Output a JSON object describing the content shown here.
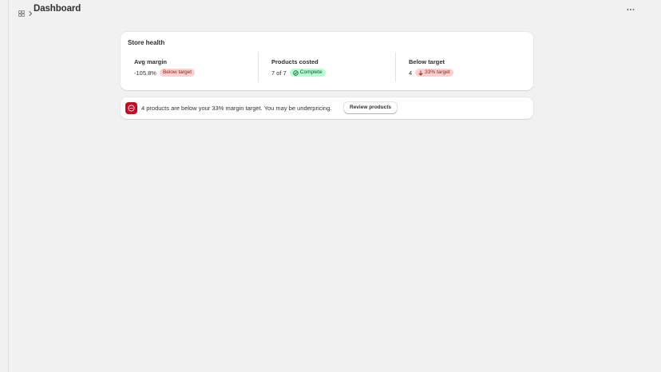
{
  "header": {
    "app_icon": "app-grid-icon",
    "separator_icon": "chevron-right-icon",
    "title": "Dashboard",
    "more_icon": "more-horizontal-icon"
  },
  "store_health": {
    "title": "Store health",
    "metrics": [
      {
        "label": "Avg margin",
        "value": "-105.8%",
        "badge": "Below target",
        "badge_tone": "critical"
      },
      {
        "label": "Products costed",
        "value": "7 of 7",
        "badge": "Complete",
        "badge_tone": "success",
        "badge_icon": "check-circle-icon"
      },
      {
        "label": "Below target",
        "value": "4",
        "badge": "33% target",
        "badge_tone": "critical",
        "badge_icon": "arrow-down-icon"
      }
    ]
  },
  "banner": {
    "icon": "alert-circle-icon",
    "message": "4 products are below your 33% margin target. You may be underpricing.",
    "action_label": "Review products"
  },
  "colors": {
    "page_background": "#f1f1f1",
    "card_background": "#ffffff",
    "critical_badge_bg": "#fdd1d1",
    "critical_badge_text": "#8e1f0b",
    "success_badge_bg": "#b4fed2",
    "success_badge_text": "#0c5132",
    "critical_icon_bg": "#c70a24",
    "text_primary": "#303030"
  }
}
